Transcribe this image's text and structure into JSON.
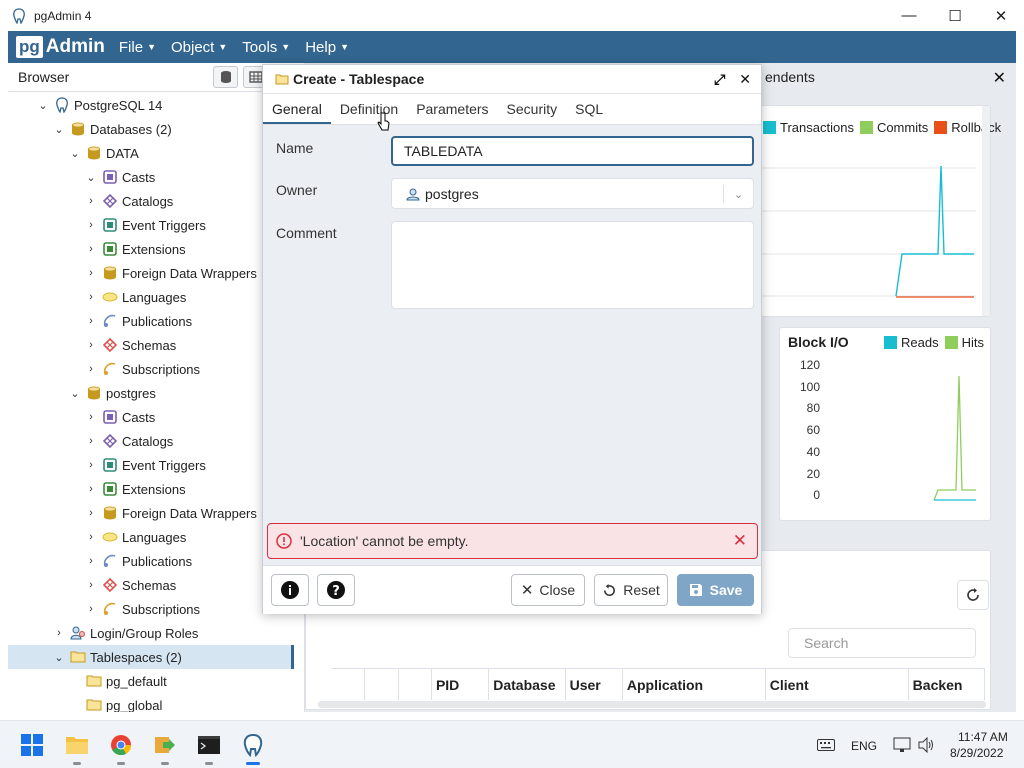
{
  "window": {
    "title": "pgAdmin 4",
    "minimize": "—",
    "maximize": "☐",
    "close": "✕"
  },
  "menubar": {
    "logo_pg": "pg",
    "logo_admin": "Admin",
    "items": [
      {
        "label": "File"
      },
      {
        "label": "Object"
      },
      {
        "label": "Tools"
      },
      {
        "label": "Help"
      }
    ]
  },
  "browser": {
    "title": "Browser",
    "tree": [
      {
        "label": "PostgreSQL 14",
        "chev": "⌄",
        "icon": "server-icon"
      },
      {
        "label": "Databases (2)",
        "chev": "⌄",
        "icon": "databases-icon"
      },
      {
        "label": "DATA",
        "chev": "⌄",
        "icon": "database-icon"
      },
      {
        "label": "Casts",
        "chev": "⌄",
        "icon": "casts-icon"
      },
      {
        "label": "Catalogs",
        "chev": "›",
        "icon": "catalogs-icon"
      },
      {
        "label": "Event Triggers",
        "chev": "›",
        "icon": "event-triggers-icon"
      },
      {
        "label": "Extensions",
        "chev": "›",
        "icon": "extensions-icon"
      },
      {
        "label": "Foreign Data Wrappers",
        "chev": "›",
        "icon": "fdw-icon"
      },
      {
        "label": "Languages",
        "chev": "›",
        "icon": "languages-icon"
      },
      {
        "label": "Publications",
        "chev": "›",
        "icon": "publications-icon"
      },
      {
        "label": "Schemas",
        "chev": "›",
        "icon": "schemas-icon"
      },
      {
        "label": "Subscriptions",
        "chev": "›",
        "icon": "subscriptions-icon"
      },
      {
        "label": "postgres",
        "chev": "⌄",
        "icon": "database-icon"
      },
      {
        "label": "Casts",
        "chev": "›",
        "icon": "casts-icon"
      },
      {
        "label": "Catalogs",
        "chev": "›",
        "icon": "catalogs-icon"
      },
      {
        "label": "Event Triggers",
        "chev": "›",
        "icon": "event-triggers-icon"
      },
      {
        "label": "Extensions",
        "chev": "›",
        "icon": "extensions-icon"
      },
      {
        "label": "Foreign Data Wrappers",
        "chev": "›",
        "icon": "fdw-icon"
      },
      {
        "label": "Languages",
        "chev": "›",
        "icon": "languages-icon"
      },
      {
        "label": "Publications",
        "chev": "›",
        "icon": "publications-icon"
      },
      {
        "label": "Schemas",
        "chev": "›",
        "icon": "schemas-icon"
      },
      {
        "label": "Subscriptions",
        "chev": "›",
        "icon": "subscriptions-icon"
      },
      {
        "label": "Login/Group Roles",
        "chev": "›",
        "icon": "roles-icon"
      },
      {
        "label": "Tablespaces (2)",
        "chev": "⌄",
        "icon": "tablespaces-icon",
        "selected": true
      },
      {
        "label": "pg_default",
        "chev": "",
        "icon": "tablespace-icon"
      },
      {
        "label": "pg_global",
        "chev": "",
        "icon": "tablespace-icon"
      }
    ]
  },
  "dashboard": {
    "tab_label": "endents",
    "close": "✕",
    "sessions_legend": [
      {
        "label": "Transactions",
        "color": "#17becf"
      },
      {
        "label": "Commits",
        "color": "#8fce5c"
      },
      {
        "label": "Rollback",
        "color": "#e8501a"
      }
    ],
    "block_io_title": "Block I/O",
    "block_io_legend": [
      {
        "label": "Reads",
        "color": "#17becf"
      },
      {
        "label": "Hits",
        "color": "#8fce5c"
      }
    ],
    "block_io_ticks": [
      "120",
      "100",
      "80",
      "60",
      "40",
      "20",
      "0"
    ],
    "search_placeholder": "Search",
    "table_headers": [
      "PID",
      "Database",
      "User",
      "Application",
      "Client",
      "Backen"
    ]
  },
  "dialog": {
    "title": "Create - Tablespace",
    "tabs": [
      "General",
      "Definition",
      "Parameters",
      "Security",
      "SQL"
    ],
    "name_label": "Name",
    "name_value": "TABLEDATA",
    "owner_label": "Owner",
    "owner_value": "postgres",
    "comment_label": "Comment",
    "comment_value": "",
    "error_text": "'Location' cannot be empty.",
    "close_label": "Close",
    "reset_label": "Reset",
    "save_label": "Save"
  },
  "taskbar": {
    "lang": "ENG",
    "time": "11:47 AM",
    "date": "8/29/2022"
  }
}
